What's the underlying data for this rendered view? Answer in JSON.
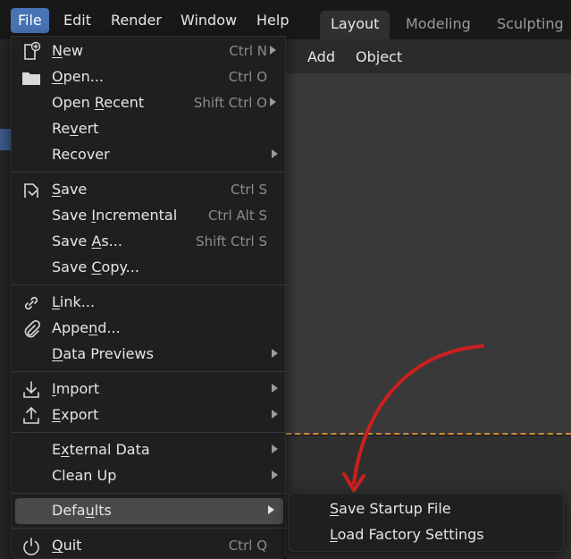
{
  "menubar": {
    "file": "File",
    "edit": "Edit",
    "render": "Render",
    "window": "Window",
    "help": "Help"
  },
  "workspaces": [
    "Layout",
    "Modeling",
    "Sculpting"
  ],
  "viewport_header": {
    "add": "Add",
    "object": "Object"
  },
  "file_menu": {
    "new": {
      "label_u": "N",
      "label_rest": "ew",
      "shortcut": "Ctrl N"
    },
    "open": {
      "label_u": "O",
      "label_rest": "pen...",
      "shortcut": "Ctrl O"
    },
    "open_recent": {
      "label_pre": "Open ",
      "label_u": "R",
      "label_rest": "ecent",
      "shortcut": "Shift Ctrl O"
    },
    "revert": {
      "label_pre": "Re",
      "label_u": "v",
      "label_rest": "ert"
    },
    "recover": {
      "label": "Recover"
    },
    "save": {
      "label_u": "S",
      "label_rest": "ave",
      "shortcut": "Ctrl S"
    },
    "save_incremental": {
      "label_pre": "Save ",
      "label_u": "I",
      "label_rest": "ncremental",
      "shortcut": "Ctrl Alt S"
    },
    "save_as": {
      "label_pre": "Save ",
      "label_u": "A",
      "label_rest": "s...",
      "shortcut": "Shift Ctrl S"
    },
    "save_copy": {
      "label_pre": "Save ",
      "label_u": "C",
      "label_rest": "opy..."
    },
    "link": {
      "label_u": "L",
      "label_rest": "ink..."
    },
    "append": {
      "label_pre": "Appe",
      "label_u": "n",
      "label_rest": "d..."
    },
    "data_previews": {
      "label_u": "D",
      "label_rest": "ata Previews"
    },
    "import": {
      "label_u": "I",
      "label_rest": "mport"
    },
    "export": {
      "label_u": "E",
      "label_rest": "xport"
    },
    "external_data": {
      "label_pre": "E",
      "label_u": "x",
      "label_rest": "ternal Data"
    },
    "clean_up": {
      "label": "Clean Up"
    },
    "defaults": {
      "label_pre": "Defa",
      "label_u": "u",
      "label_rest": "lts"
    },
    "quit": {
      "label_u": "Q",
      "label_rest": "uit",
      "shortcut": "Ctrl Q"
    }
  },
  "defaults_submenu": {
    "save_startup": {
      "label_u": "S",
      "label_rest": "ave Startup File"
    },
    "load_factory": {
      "label_u": "L",
      "label_rest": "oad Factory Settings"
    }
  },
  "colors": {
    "active_menu": "#4772b3",
    "annotation_arrow": "#cc1f1f",
    "divider": "#d08a3a"
  }
}
